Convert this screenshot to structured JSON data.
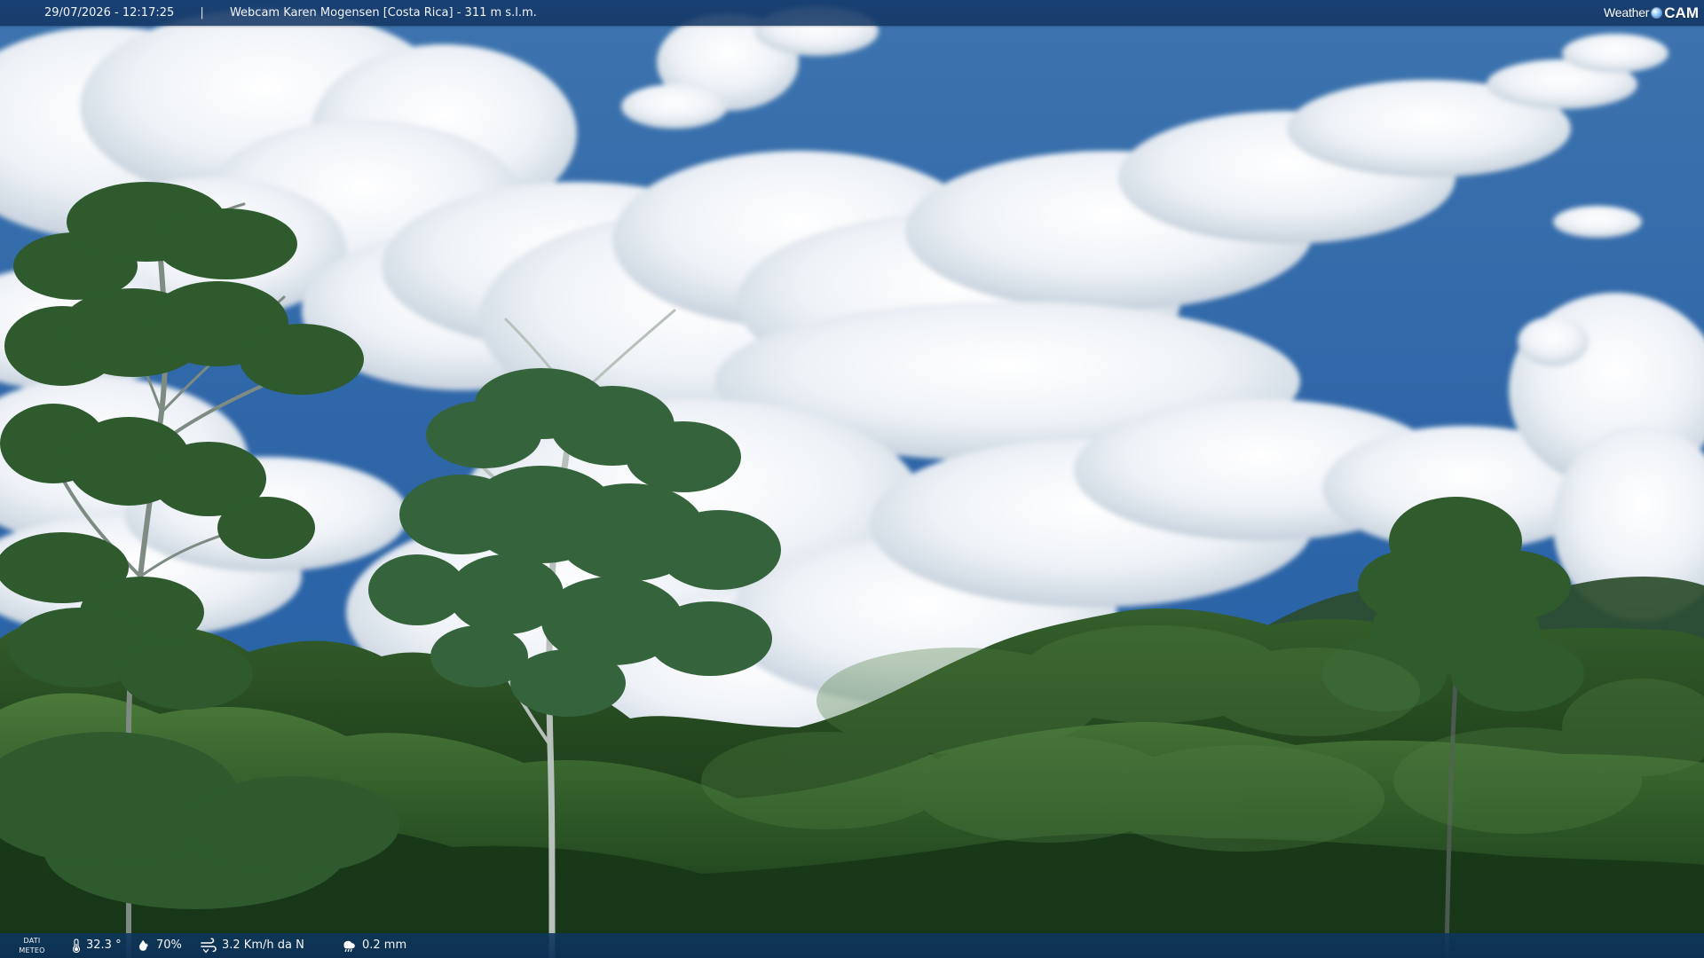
{
  "header": {
    "datetime": "29/07/2026 - 12:17:25",
    "separator": "|",
    "camera_title": "Webcam Karen Mogensen [Costa Rica] - 311 m s.l.m.",
    "brand_left": "Weather",
    "brand_right": "CAM"
  },
  "footer": {
    "label_line_1": "DATI",
    "label_line_2": "METEO",
    "temperature": "32.3 °",
    "humidity": "70%",
    "wind": "3.2 Km/h da N",
    "rain": "0.2 mm"
  },
  "icons": {
    "temperature": "thermometer-icon",
    "humidity": "humidity-drop-icon",
    "wind": "wind-icon",
    "rain": "rain-icon"
  },
  "colors": {
    "sky": "#2f68ad",
    "overlay_bar": "#163c6e",
    "foliage_dark": "#163617",
    "foliage_mid": "#2d5c2a",
    "text": "#f1f4f7"
  }
}
